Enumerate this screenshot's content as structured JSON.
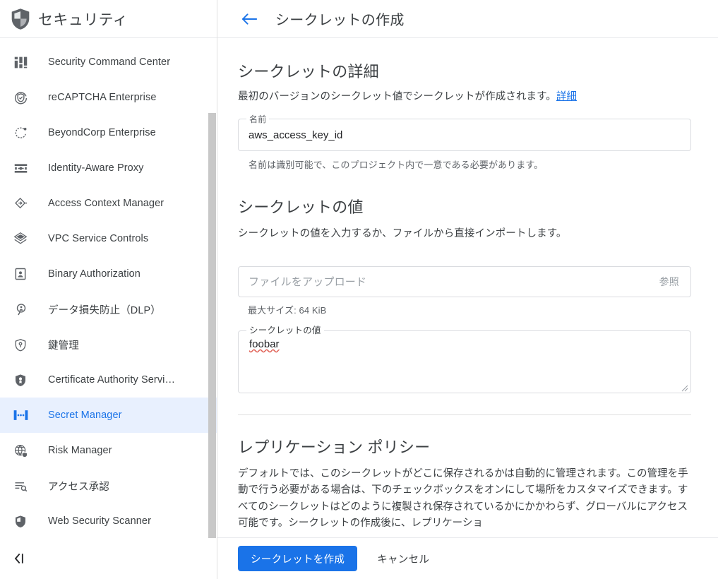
{
  "sidebar": {
    "header": {
      "title": "セキュリティ",
      "logo_icon": "shield-icon"
    },
    "items": [
      {
        "label": "Security Command Center",
        "icon": "dashboard-icon",
        "active": false
      },
      {
        "label": "reCAPTCHA Enterprise",
        "icon": "recaptcha-shield-icon",
        "active": false
      },
      {
        "label": "BeyondCorp Enterprise",
        "icon": "beyondcorp-circle-icon",
        "active": false
      },
      {
        "label": "Identity-Aware Proxy",
        "icon": "iap-icon",
        "active": false
      },
      {
        "label": "Access Context Manager",
        "icon": "diamond-arrow-icon",
        "active": false
      },
      {
        "label": "VPC Service Controls",
        "icon": "layers-diamond-icon",
        "active": false
      },
      {
        "label": "Binary Authorization",
        "icon": "badge-person-icon",
        "active": false
      },
      {
        "label": "データ損失防止（DLP）",
        "icon": "magnifier-person-icon",
        "active": false
      },
      {
        "label": "鍵管理",
        "icon": "key-shield-icon",
        "active": false
      },
      {
        "label": "Certificate Authority Servi…",
        "icon": "certificate-shield-icon",
        "active": false
      },
      {
        "label": "Secret Manager",
        "icon": "secret-brackets-icon",
        "active": true
      },
      {
        "label": "Risk Manager",
        "icon": "globe-shield-icon",
        "active": false
      },
      {
        "label": "アクセス承認",
        "icon": "list-search-icon",
        "active": false
      },
      {
        "label": "Web Security Scanner",
        "icon": "shield-solid-icon",
        "active": false
      }
    ],
    "collapse_icon": "collapse-panel-icon"
  },
  "main": {
    "header": {
      "back_icon": "arrow-back-icon",
      "title": "シークレットの作成"
    },
    "details": {
      "title": "シークレットの詳細",
      "description": "最初のバージョンのシークレット値でシークレットが作成されます。",
      "description_link": "詳細",
      "name_field": {
        "label": "名前",
        "value": "aws_access_key_id",
        "placeholder": "",
        "hint": "名前は識別可能で、このプロジェクト内で一意である必要があります。"
      }
    },
    "secret_value": {
      "title": "シークレットの値",
      "description": "シークレットの値を入力するか、ファイルから直接インポートします。",
      "upload": {
        "placeholder": "ファイルをアップロード",
        "browse_label": "参照",
        "size_hint": "最大サイズ: 64 KiB"
      },
      "textarea": {
        "label": "シークレットの値",
        "value": "foobar"
      }
    },
    "replication": {
      "title": "レプリケーション ポリシー",
      "body": "デフォルトでは、このシークレットがどこに保存されるかは自動的に管理されます。この管理を手動で行う必要がある場合は、下のチェックボックスをオンにして場所をカスタマイズできます。すべてのシークレットはどのように複製され保存されているかにかかわらず、グローバルにアクセス可能です。シークレットの作成後に、レプリケーショ"
    },
    "footer": {
      "primary_label": "シークレットを作成",
      "cancel_label": "キャンセル"
    }
  },
  "colors": {
    "accent": "#1a73e8",
    "active_bg": "#e8f0fe",
    "text": "#3c4043",
    "muted": "#5f6368",
    "placeholder": "#9aa0a6",
    "border": "#dadce0",
    "spellcheck": "#e06055"
  }
}
